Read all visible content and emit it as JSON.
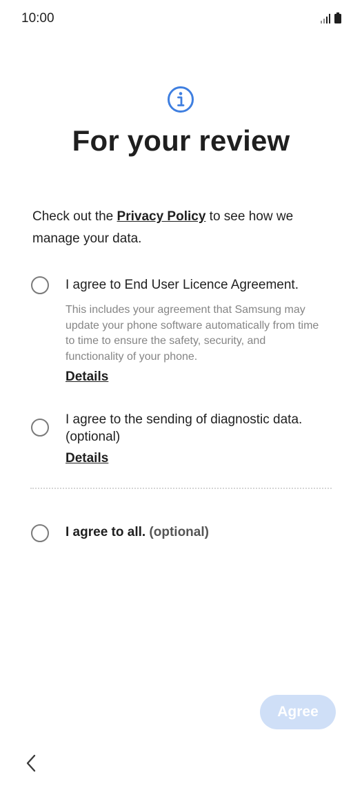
{
  "status_bar": {
    "time": "10:00",
    "signal_icon": "signal-icon",
    "battery_icon": "battery-icon"
  },
  "header": {
    "icon": "info-icon",
    "accent_color": "#3f7fe0",
    "title": "For your review"
  },
  "intro": {
    "prefix": "Check out the ",
    "link": "Privacy Policy",
    "suffix": " to see how we manage your data."
  },
  "options": [
    {
      "label": "I agree to End User Licence Agreement.",
      "description": "This includes your agreement that Samsung may update your phone software automatically from time to time to ensure the safety, security, and functionality of your phone.",
      "details": "Details",
      "checked": false
    },
    {
      "label": "I agree to the sending of diagnostic data. (optional)",
      "details": "Details",
      "checked": false
    }
  ],
  "agree_all": {
    "label": "I agree to all.",
    "optional": " (optional)",
    "checked": false
  },
  "footer": {
    "agree_label": "Agree",
    "agree_enabled": false,
    "agree_color": "#cfdff7",
    "back_icon": "chevron-left-icon"
  }
}
